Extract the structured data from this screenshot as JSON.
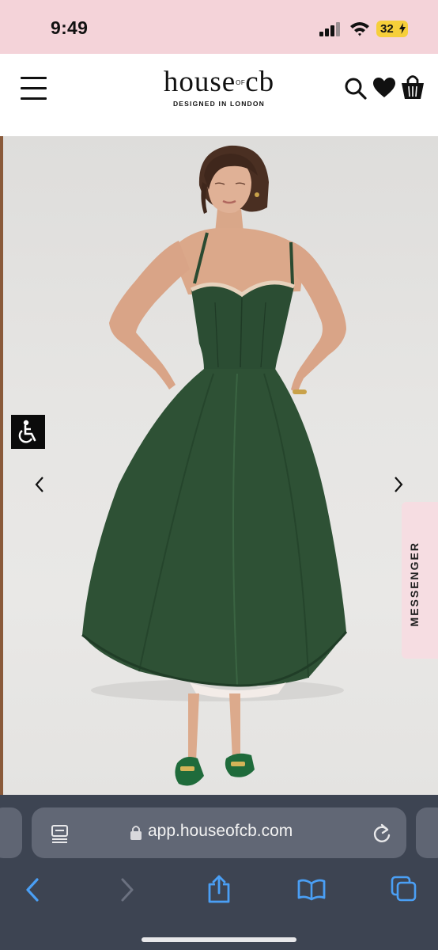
{
  "status_bar": {
    "time": "9:49",
    "battery_level": "32",
    "battery_color": "#f6cf3a",
    "icons": [
      "signal-icon",
      "wifi-icon",
      "battery-icon"
    ]
  },
  "header": {
    "logo_main_left": "house",
    "logo_of": "OF",
    "logo_main_right": "cb",
    "logo_tagline": "DESIGNED IN LONDON",
    "icons": [
      "menu-icon",
      "search-icon",
      "heart-icon",
      "bag-icon"
    ]
  },
  "gallery": {
    "dress_color": "#2e5135",
    "icons": [
      "chevron-left-icon",
      "chevron-right-icon",
      "accessibility-icon"
    ],
    "messenger_label": "MESSENGER"
  },
  "browser": {
    "url": "app.houseofcb.com",
    "accent": "#4a9ff5",
    "icons": [
      "reader-icon",
      "lock-icon",
      "reload-icon",
      "back-icon",
      "forward-icon",
      "share-icon",
      "bookmarks-icon",
      "tabs-icon"
    ]
  }
}
